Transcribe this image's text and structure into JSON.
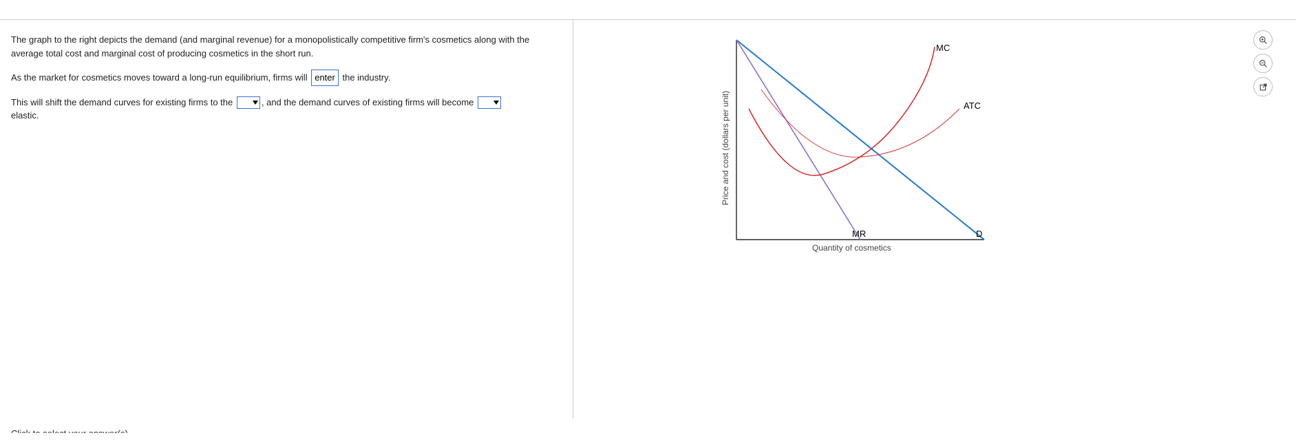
{
  "question": {
    "paragraph1": "The graph to the right depicts the demand (and marginal revenue) for a monopolistically competitive firm's cosmetics along with the average total cost and marginal cost of producing cosmetics in the short run.",
    "sentence2_pre": "As the market for cosmetics moves toward a long-run equilibrium, firms will",
    "answer1": "enter",
    "sentence2_post": "the industry.",
    "sentence3_pre": "This will shift the demand curves for existing firms to the",
    "sentence3_mid": ", and the demand curves of existing firms will become",
    "sentence3_post": "elastic."
  },
  "dropdowns": {
    "shift_direction": "",
    "elasticity_change": ""
  },
  "chart_data": {
    "type": "line",
    "title": "",
    "xlabel": "Quantity of cosmetics",
    "ylabel": "Price and cost (dollars per unit)",
    "xrange": [
      0,
      10
    ],
    "yrange": [
      0,
      10
    ],
    "series": [
      {
        "name": "D",
        "points": [
          [
            0,
            10
          ],
          [
            10,
            0
          ]
        ],
        "color": "#1f78d1"
      },
      {
        "name": "MR",
        "points": [
          [
            0,
            10
          ],
          [
            5,
            0
          ]
        ],
        "color": "#8a6fd1"
      },
      {
        "name": "MC",
        "points": [
          [
            0.5,
            6
          ],
          [
            2,
            3.2
          ],
          [
            3.5,
            3.4
          ],
          [
            5,
            5
          ],
          [
            6.5,
            7.5
          ],
          [
            8,
            10
          ]
        ],
        "color": "#d62728"
      },
      {
        "name": "ATC",
        "points": [
          [
            1,
            7.5
          ],
          [
            2.5,
            5
          ],
          [
            4,
            4.2
          ],
          [
            5.5,
            4.4
          ],
          [
            7,
            5.2
          ],
          [
            9,
            7
          ]
        ],
        "color": "#d62728"
      }
    ],
    "labels": {
      "MC": {
        "x": 8.0,
        "y": 9.5
      },
      "ATC": {
        "x": 9.3,
        "y": 6.8
      },
      "MR": {
        "x": 5.0,
        "y": 0.3
      },
      "D": {
        "x": 9.8,
        "y": 0.3
      }
    }
  },
  "tools": {
    "zoom_in": "zoom-in",
    "zoom_out": "zoom-out",
    "open_new": "open-in-new"
  },
  "footer_cut_text": "Click to select your answer(s)"
}
